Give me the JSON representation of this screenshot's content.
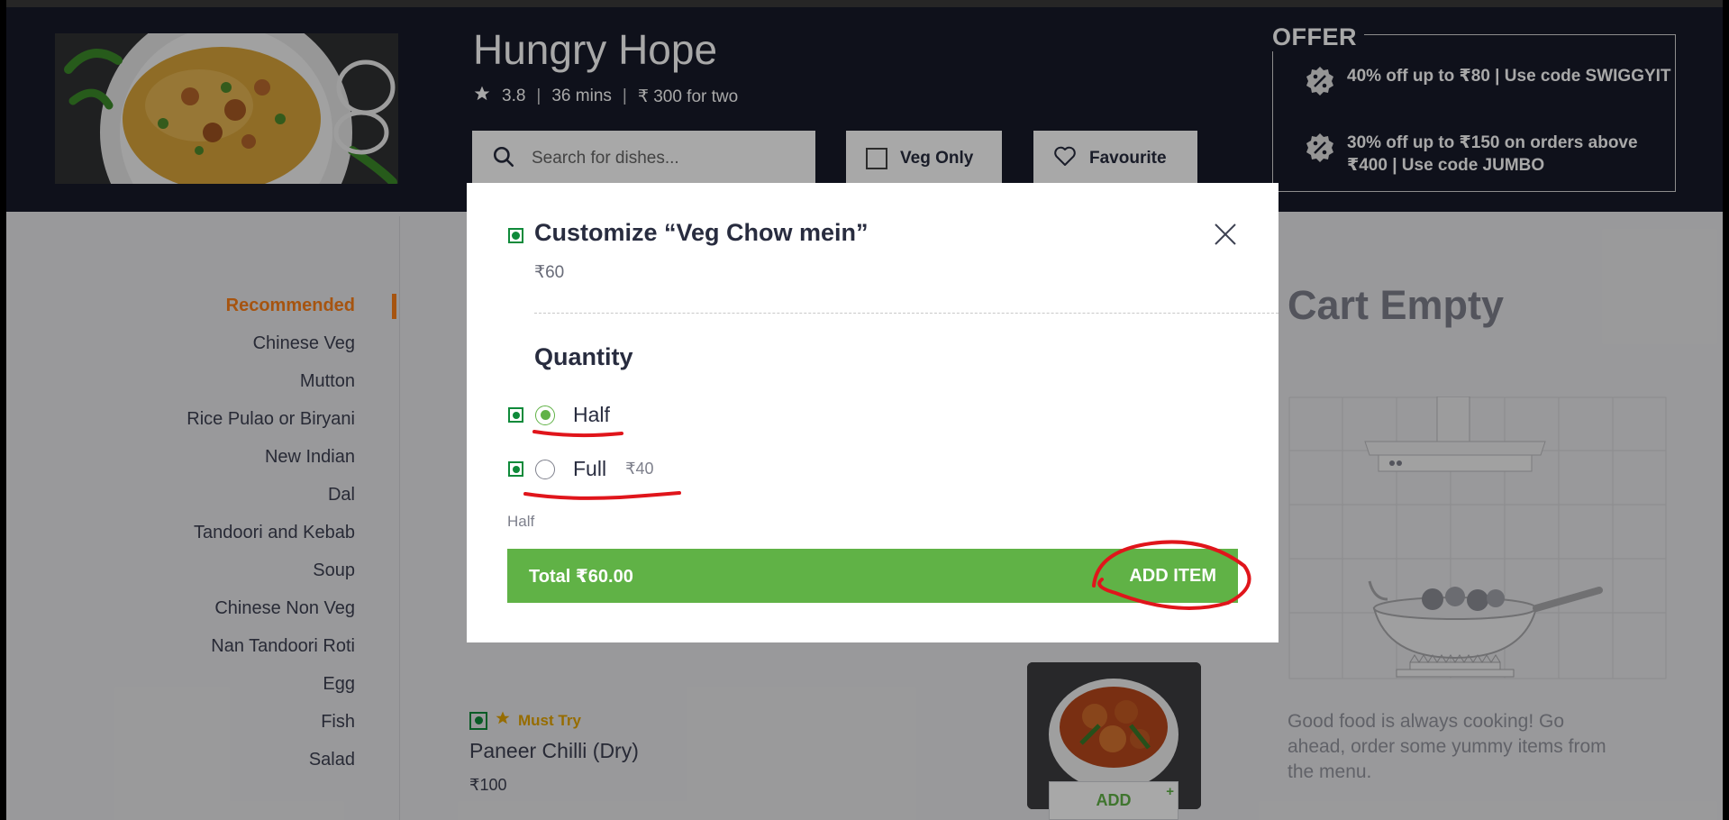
{
  "restaurant": {
    "name": "Hungry Hope",
    "rating": "3.8",
    "delivery_time": "36 mins",
    "cost_for_two": "₹ 300 for two",
    "meta_separator": "|"
  },
  "search": {
    "placeholder": "Search for dishes..."
  },
  "filters": {
    "veg_only_label": "Veg Only",
    "favourite_label": "Favourite"
  },
  "offers": {
    "title": "OFFER",
    "items": [
      {
        "text": "40% off up to ₹80 | Use code SWIGGYIT"
      },
      {
        "text": "30% off up to ₹150 on orders above ₹400 | Use code JUMBO"
      }
    ]
  },
  "sidebar": {
    "items": [
      {
        "label": "Recommended",
        "active": true
      },
      {
        "label": "Chinese Veg"
      },
      {
        "label": "Mutton"
      },
      {
        "label": "Rice Pulao or Biryani"
      },
      {
        "label": "New Indian"
      },
      {
        "label": "Dal"
      },
      {
        "label": "Tandoori and Kebab"
      },
      {
        "label": "Soup"
      },
      {
        "label": "Chinese Non Veg"
      },
      {
        "label": "Nan Tandoori Roti"
      },
      {
        "label": "Egg"
      },
      {
        "label": "Fish"
      },
      {
        "label": "Salad"
      }
    ]
  },
  "dish": {
    "badge": "Must Try",
    "name": "Paneer Chilli (Dry)",
    "price": "₹100",
    "add_label": "ADD",
    "add_plus": "+"
  },
  "cart": {
    "title": "Cart Empty",
    "message": "Good food is always cooking! Go ahead, order some yummy items from the menu."
  },
  "modal": {
    "title": "Customize “Veg Chow mein”",
    "price": "₹60",
    "quantity_label": "Quantity",
    "options": [
      {
        "label": "Half",
        "price": "",
        "selected": true
      },
      {
        "label": "Full",
        "price": "₹40",
        "selected": false
      }
    ],
    "selected_summary": "Half",
    "total_label": "Total ₹60.00",
    "add_item_label": "ADD ITEM"
  },
  "colors": {
    "header_bg": "#171a29",
    "accent_orange": "#fc8019",
    "green": "#60b246",
    "veg_green": "#0f8a3a",
    "annotation_red": "#e0151b"
  }
}
